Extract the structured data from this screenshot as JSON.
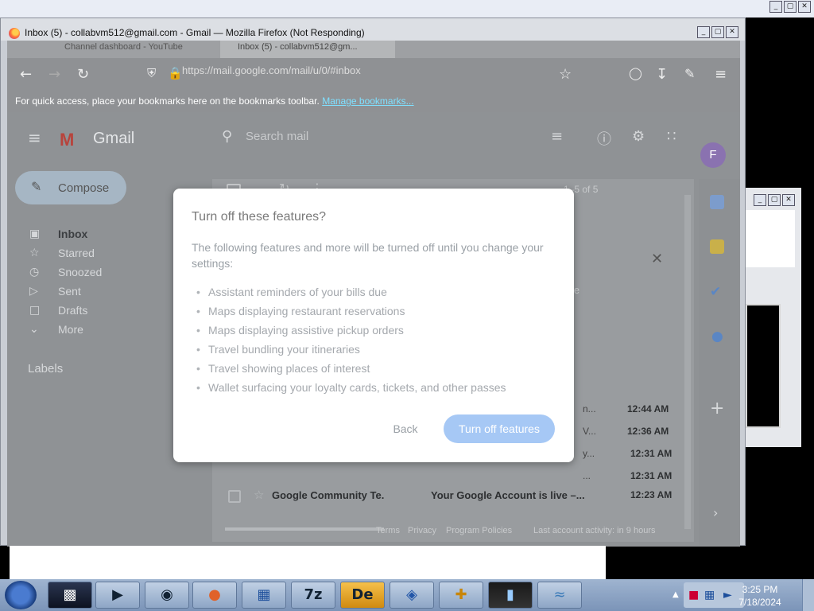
{
  "desktop": {
    "top_controls": [
      "_",
      "▢",
      "✕"
    ]
  },
  "window": {
    "title": "Inbox (5) - collabvm512@gmail.com - Gmail — Mozilla Firefox (Not Responding)",
    "controls": [
      "_",
      "▢",
      "✕"
    ]
  },
  "browser": {
    "tabs": [
      "Channel dashboard - YouTube",
      "Inbox (5) - collabvm512@gm..."
    ],
    "url": "https://mail.google.com/mail/u/0/#inbox",
    "bookmarks_bar_text": "For quick access, place your bookmarks here on the bookmarks toolbar.",
    "bookmarks_link": "Manage bookmarks..."
  },
  "gmail": {
    "brand": "Gmail",
    "search_placeholder": "Search mail",
    "compose": "Compose",
    "nav": [
      {
        "label": "Inbox",
        "icon": "inbox-icon"
      },
      {
        "label": "Starred",
        "icon": "star-icon"
      },
      {
        "label": "Snoozed",
        "icon": "clock-icon"
      },
      {
        "label": "Sent",
        "icon": "send-icon"
      },
      {
        "label": "Drafts",
        "icon": "draft-icon"
      },
      {
        "label": "More",
        "icon": "chevron-down-icon"
      }
    ],
    "labels_heading": "Labels",
    "pagination": "1–5 of 5",
    "avatar_initial": "F",
    "rows": [
      {
        "snippet": "n...",
        "time": "12:44 AM"
      },
      {
        "snippet": "V...",
        "time": "12:36 AM"
      },
      {
        "snippet": "y...",
        "time": "12:31 AM"
      },
      {
        "snippet": "...",
        "time": "12:31 AM"
      },
      {
        "sender": "Google Community Te.",
        "snippet": "Your Google Account is live –...",
        "time": "12:23 AM"
      }
    ],
    "footer": {
      "terms": "Terms",
      "privacy": "Privacy",
      "program": "Program Policies",
      "activity": "Last account activity: in 9 hours"
    },
    "partial_text": "le"
  },
  "modal": {
    "title": "Turn off these features?",
    "description": "The following features and more will be turned off until you change your settings:",
    "items": [
      "Assistant reminders of your bills due",
      "Maps displaying restaurant reservations",
      "Maps displaying assistive pickup orders",
      "Travel bundling your itineraries",
      "Travel showing places of interest",
      "Wallet surfacing your loyalty cards, tickets, and other passes"
    ],
    "back": "Back",
    "confirm": "Turn off features"
  },
  "taskbar": {
    "time": "3:25 PM",
    "date": "7/18/2024",
    "apps": [
      "terminal-icon",
      "media-player-icon",
      "globe-icon",
      "firefox-icon",
      "virtualbox-icon",
      "7z-icon",
      "de-icon",
      "network-icon",
      "x64-icon",
      "monitor-icon",
      "dolphin-icon"
    ],
    "seven_zip_label": "7z",
    "de_label": "De"
  }
}
